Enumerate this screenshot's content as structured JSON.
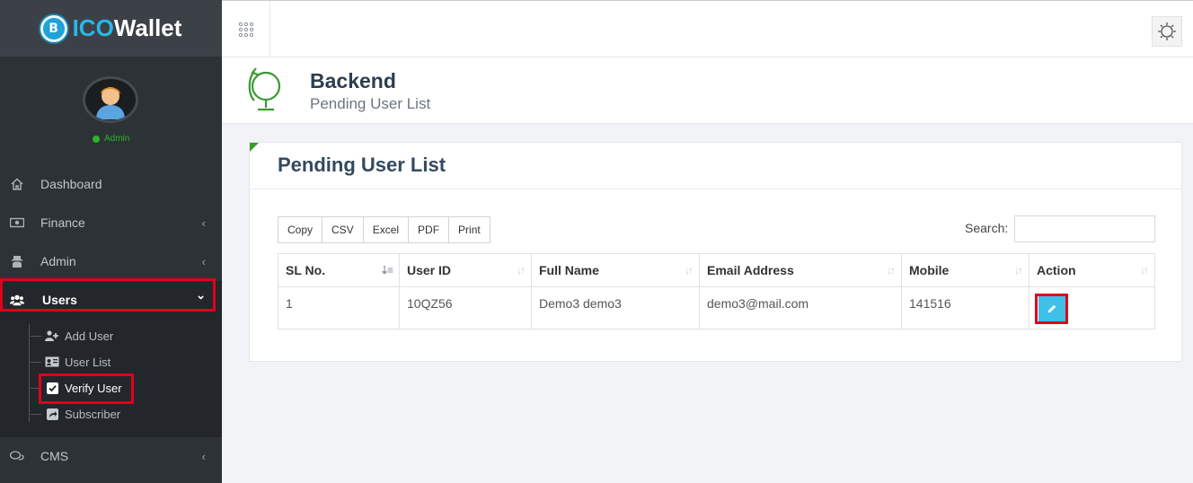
{
  "brand": {
    "ico": "ICO",
    "wallet": "Wallet",
    "coin_letter": "B",
    "icon": "bitcoin-coin-icon"
  },
  "profile": {
    "status": "Admin",
    "status_color": "#2db32d"
  },
  "sidebar": {
    "items": [
      {
        "label": "Dashboard",
        "icon": "home-icon"
      },
      {
        "label": "Finance",
        "icon": "money-icon",
        "chevron": "‹"
      },
      {
        "label": "Admin",
        "icon": "user-secret-icon",
        "chevron": "‹"
      },
      {
        "label": "Users",
        "icon": "users-icon",
        "chevron": "⌄"
      },
      {
        "label": "CMS",
        "icon": "comments-icon",
        "chevron": "‹"
      }
    ],
    "users_submenu": [
      {
        "label": "Add User",
        "icon": "user-plus-icon"
      },
      {
        "label": "User List",
        "icon": "id-card-icon"
      },
      {
        "label": "Verify User",
        "icon": "check-square-icon"
      },
      {
        "label": "Subscriber",
        "icon": "share-square-icon"
      }
    ]
  },
  "header": {
    "title": "Backend",
    "subtitle": "Pending User List"
  },
  "panel": {
    "title": "Pending User List"
  },
  "toolbar": {
    "buttons": [
      "Copy",
      "CSV",
      "Excel",
      "PDF",
      "Print"
    ]
  },
  "search": {
    "label": "Search:",
    "value": ""
  },
  "table": {
    "columns": [
      "SL No.",
      "User ID",
      "Full Name",
      "Email Address",
      "Mobile",
      "Action"
    ],
    "rows": [
      [
        "1",
        "10QZ56",
        "Demo3 demo3",
        "demo3@mail.com",
        "141516"
      ]
    ]
  },
  "colors": {
    "accent": "#3a9a2f",
    "edit_button": "#3fc0e9",
    "highlight": "#e0001a",
    "brand_blue": "#29b6e8"
  }
}
